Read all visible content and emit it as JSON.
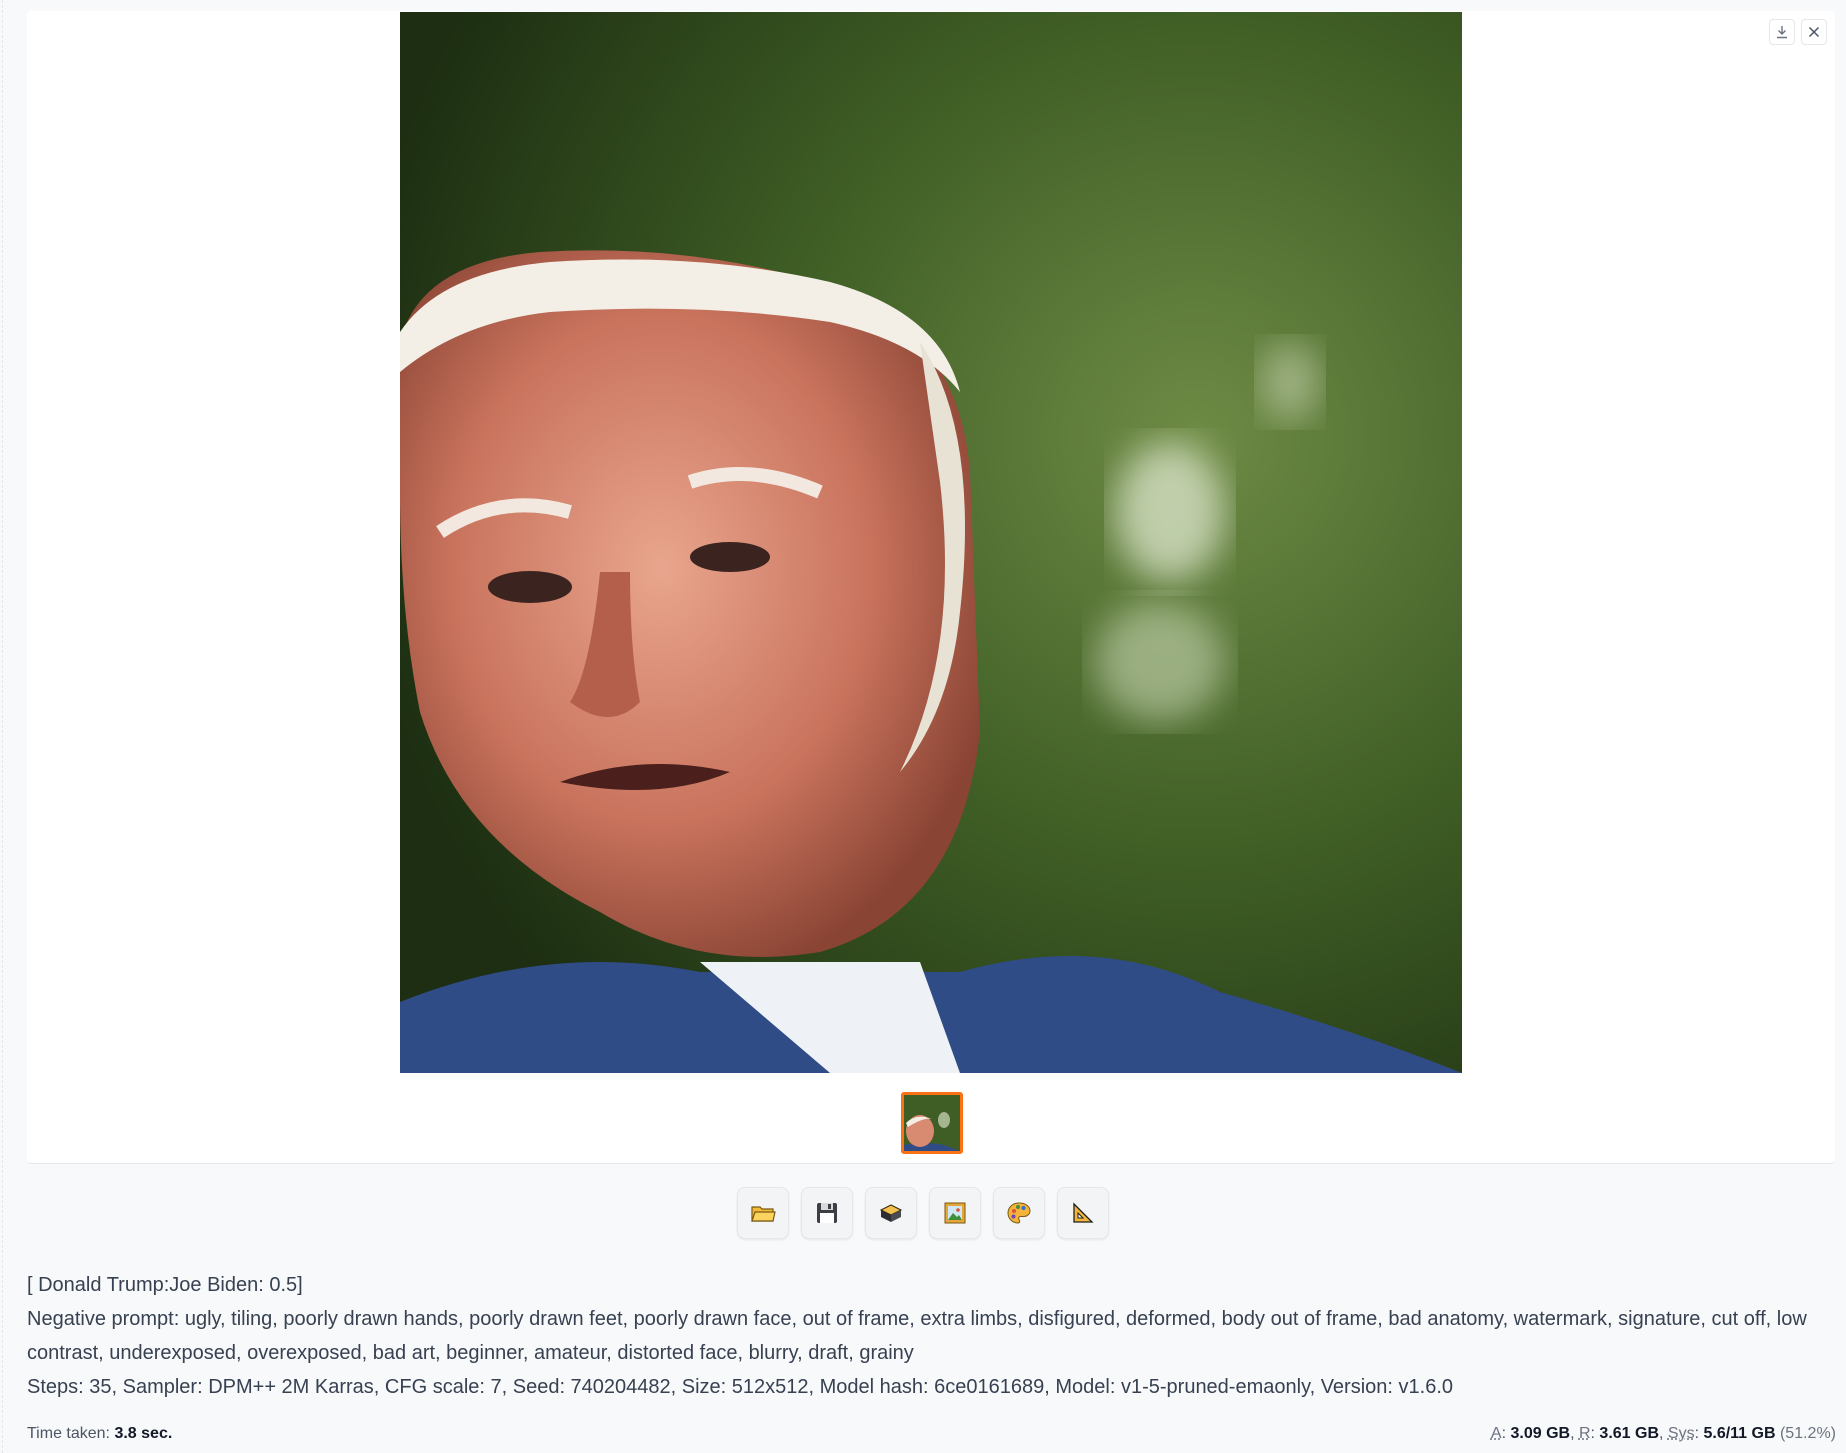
{
  "gallery": {
    "toolbar": {
      "download_icon": "download-icon",
      "close_icon": "close-icon"
    },
    "main_image": {
      "description_icon": "generated-portrait-image"
    },
    "thumbnails": [
      {
        "selected": true,
        "icon": "thumbnail-image"
      }
    ]
  },
  "actions": [
    {
      "name": "open-folder-button",
      "icon": "folder-icon"
    },
    {
      "name": "save-button",
      "icon": "floppy-disk-icon"
    },
    {
      "name": "zip-button",
      "icon": "package-icon"
    },
    {
      "name": "send-to-img2img-button",
      "icon": "picture-icon"
    },
    {
      "name": "send-to-inpaint-button",
      "icon": "palette-icon"
    },
    {
      "name": "send-to-extras-button",
      "icon": "triangle-ruler-icon"
    }
  ],
  "generation_info": {
    "prompt": "[ Donald Trump:Joe Biden: 0.5]",
    "negative_prompt": "Negative prompt: ugly, tiling, poorly drawn hands, poorly drawn feet, poorly drawn face, out of frame, extra limbs, disfigured, deformed, body out of frame, bad anatomy, watermark, signature, cut off, low contrast, underexposed, overexposed, bad art, beginner, amateur, distorted face, blurry, draft, grainy",
    "params": "Steps: 35, Sampler: DPM++ 2M Karras, CFG scale: 7, Seed: 740204482, Size: 512x512, Model hash: 6ce0161689, Model: v1-5-pruned-emaonly, Version: v1.6.0"
  },
  "footer": {
    "time_label": "Time taken:",
    "time_value": "3.8 sec.",
    "a_label": "A",
    "a_value": "3.09 GB",
    "r_label": "R",
    "r_value": "3.61 GB",
    "sys_label": "Sys",
    "sys_value": "5.6/11 GB",
    "sys_pct": "(51.2%)"
  },
  "colors": {
    "accent": "#f97316",
    "background": "#f8f9fb"
  }
}
